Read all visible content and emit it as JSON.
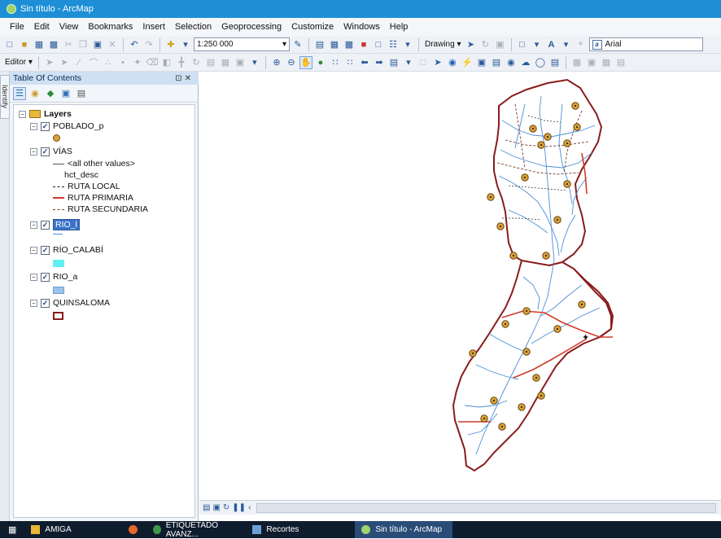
{
  "window": {
    "title": "Sin título - ArcMap"
  },
  "menu": [
    "File",
    "Edit",
    "View",
    "Bookmarks",
    "Insert",
    "Selection",
    "Geoprocessing",
    "Customize",
    "Windows",
    "Help"
  ],
  "toolbar": {
    "scale_value": "1:250 000",
    "drawing_label": "Drawing",
    "font_value": "Arial",
    "editor_label": "Editor"
  },
  "identify_tab": {
    "label": "Identify"
  },
  "toc": {
    "title": "Table Of Contents",
    "root": "Layers",
    "layers": [
      {
        "name": "POBLADO_p"
      },
      {
        "name": "VÍAS",
        "field": "hct_desc",
        "legend": [
          "<all other values>",
          "RUTA LOCAL",
          "RUTA PRIMARIA",
          "RUTA SECUNDARIA"
        ]
      },
      {
        "name": "RIO_l"
      },
      {
        "name": "RÍO_CALABÍ"
      },
      {
        "name": "RIO_a"
      },
      {
        "name": "QUINSALOMA"
      }
    ]
  },
  "colors": {
    "poblado": "#d9a33a",
    "ruta_local": "#222222",
    "ruta_primaria": "#d23a2a",
    "ruta_secundaria": "#7a3a2a",
    "rio_l": "#4a8fd6",
    "rio_calabi": "#5ff0f0",
    "rio_a": "#9cc3ec",
    "quinsaloma": "#8a1c1c",
    "titlebar": "#1e8fd6"
  },
  "taskbar": {
    "items": [
      "AMIGA",
      "ETIQUETADO AVANZ...",
      "Recortes",
      "Sin título - ArcMap"
    ]
  }
}
